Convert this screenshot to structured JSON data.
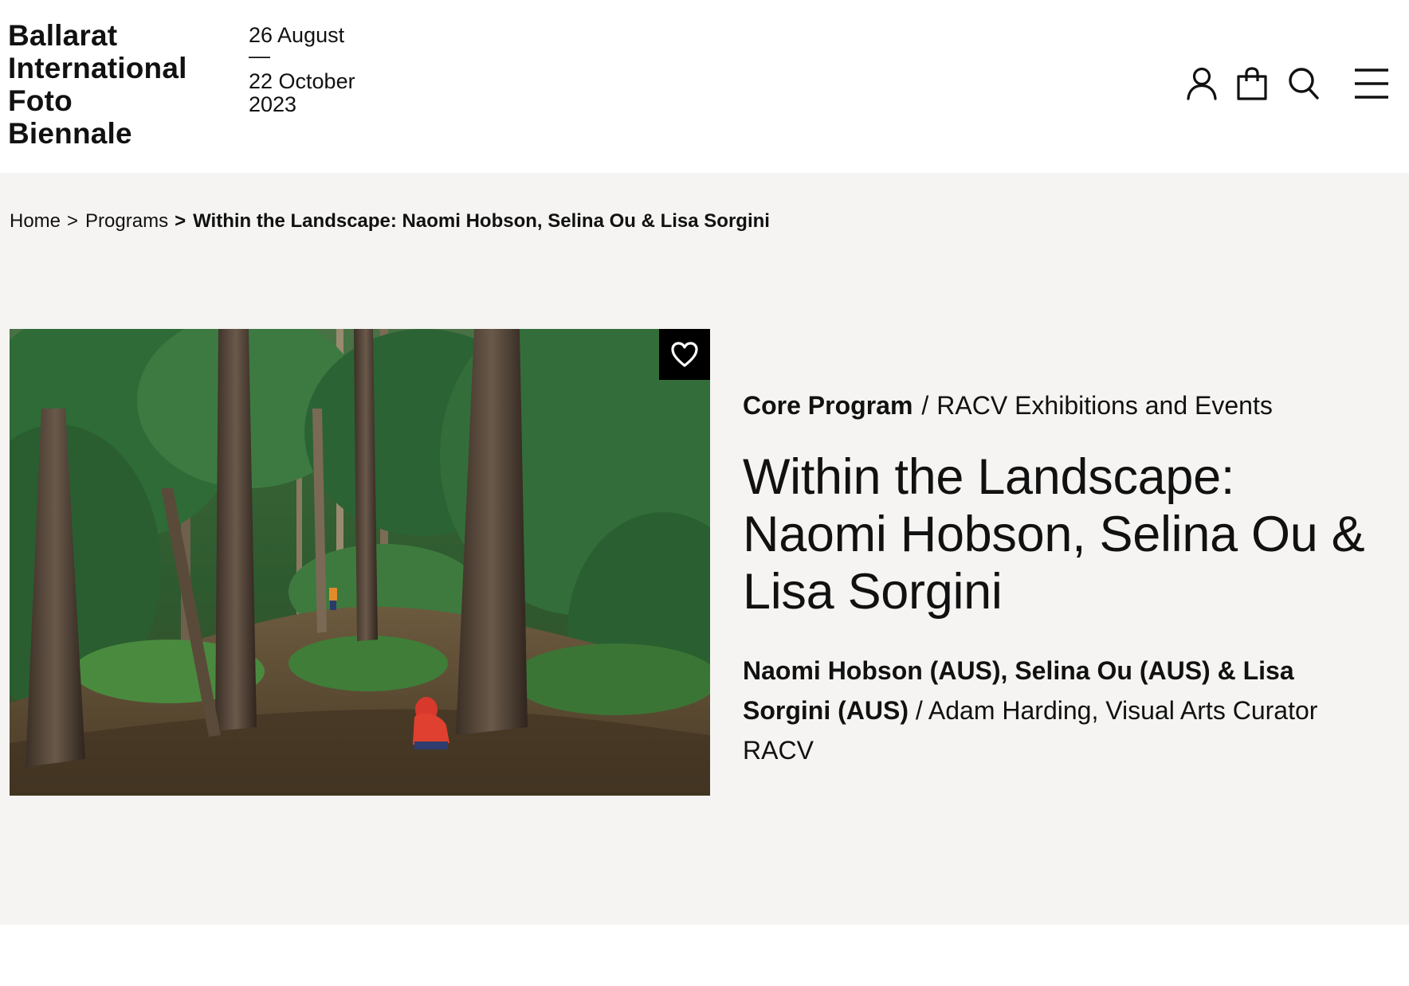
{
  "header": {
    "logo_lines": [
      "Ballarat",
      "International",
      "Foto",
      "Biennale"
    ],
    "dates": {
      "start": "26 August",
      "dash": "—",
      "end_line1": "22 October",
      "end_line2": "2023"
    },
    "icons": [
      "account-icon",
      "bag-icon",
      "search-icon",
      "menu-icon"
    ]
  },
  "breadcrumb": {
    "items": [
      "Home",
      "Programs"
    ],
    "separator": ">",
    "current": "Within the Landscape: Naomi Hobson, Selina Ou & Lisa Sorgini"
  },
  "event": {
    "category_primary": "Core Program",
    "category_separator": "/",
    "category_secondary": "RACV Exhibitions and Events",
    "title": "Within the Landscape: Naomi Hobson, Selina Ou & Lisa Sorgini",
    "artists": "Naomi Hobson (AUS), Selina Ou (AUS) & Lisa Sorgini (AUS)",
    "artists_separator": "/",
    "curator": "Adam Harding, Visual Arts Curator RACV"
  },
  "colors": {
    "page_background": "#f5f4f2",
    "text": "#111111",
    "favorite_button": "#000000"
  }
}
